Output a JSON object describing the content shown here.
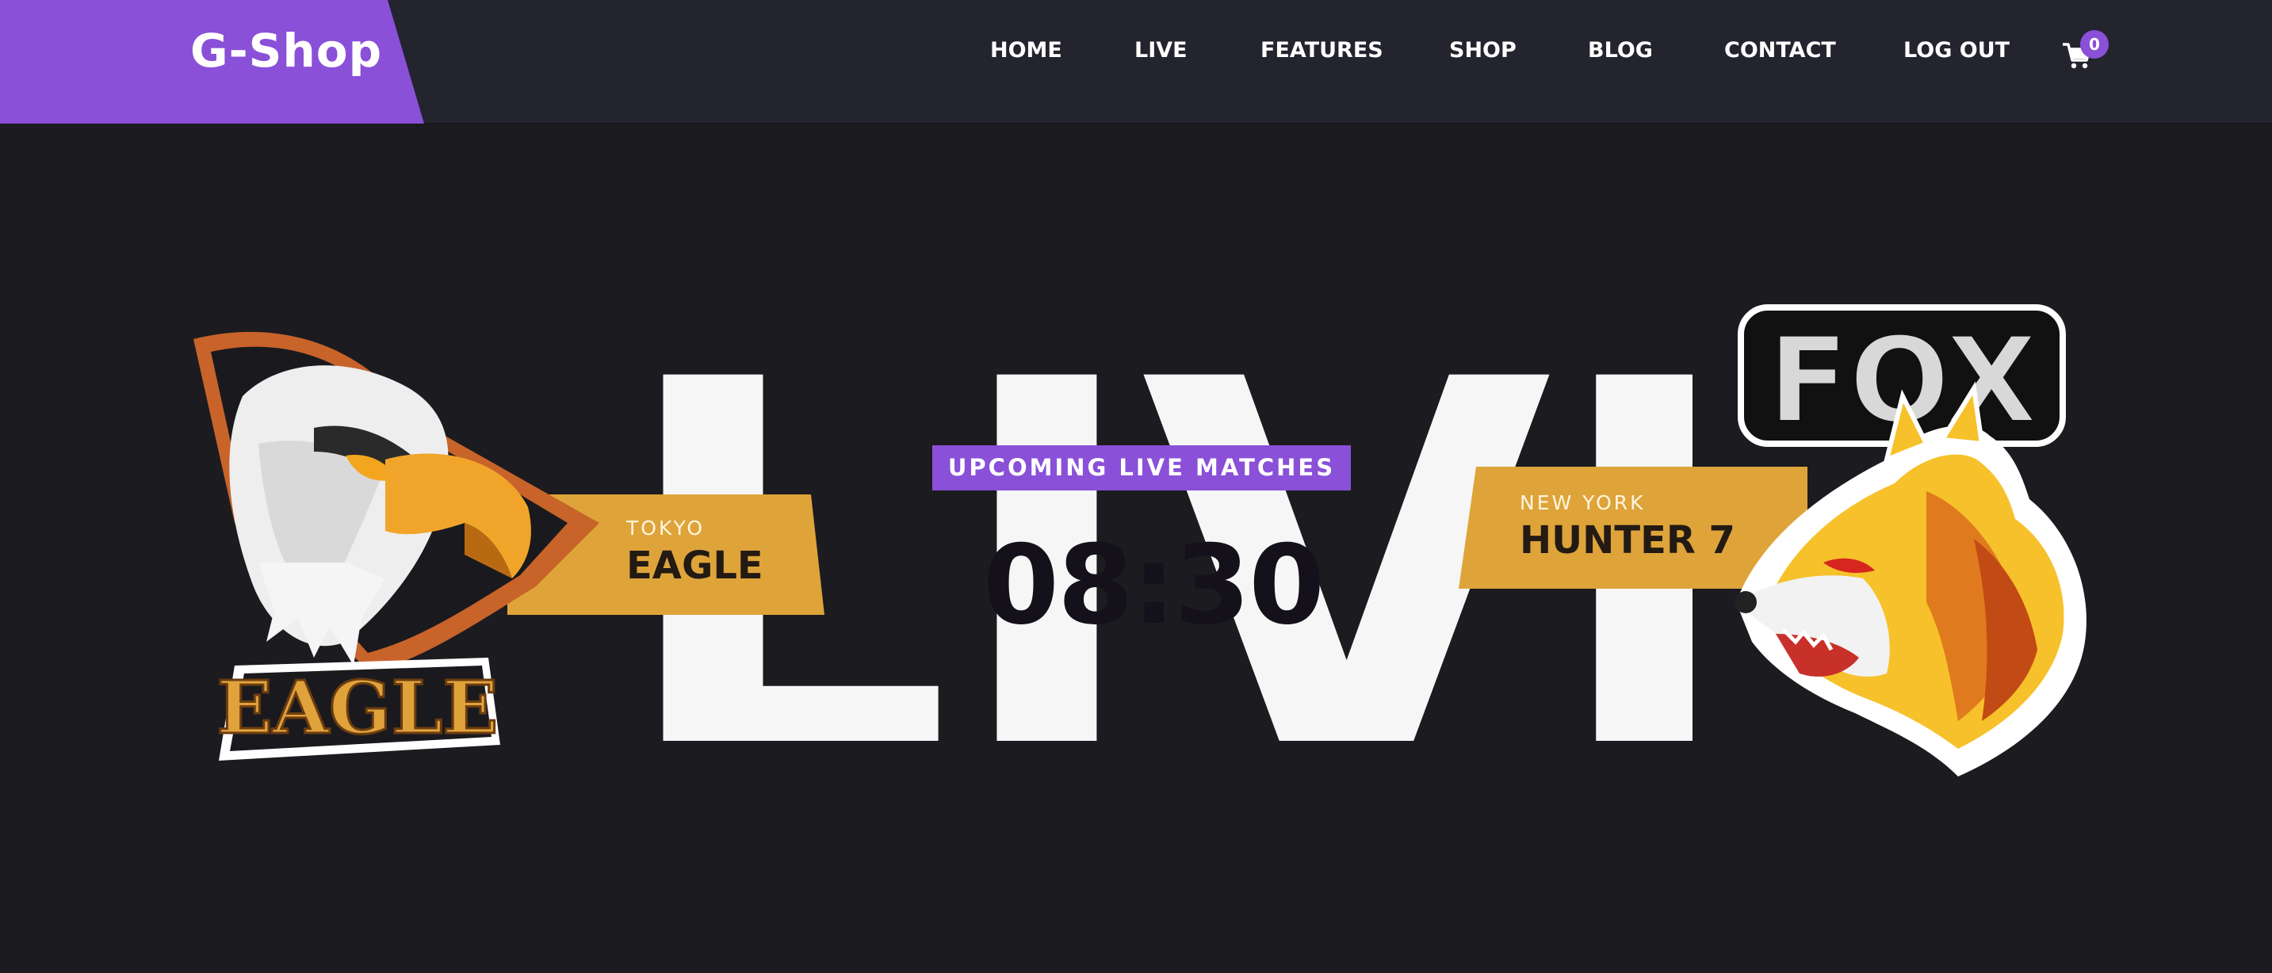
{
  "brand": {
    "name": "G-Shop"
  },
  "nav": {
    "items": [
      {
        "label": "HOME"
      },
      {
        "label": "LIVE"
      },
      {
        "label": "FEATURES"
      },
      {
        "label": "SHOP"
      },
      {
        "label": "BLOG"
      },
      {
        "label": "CONTACT"
      },
      {
        "label": "LOG OUT"
      }
    ],
    "cart": {
      "icon": "cart-icon",
      "count": "0"
    }
  },
  "hero": {
    "background_word": "LIVE",
    "badge_label": "UPCOMING LIVE MATCHES",
    "countdown": "08:30",
    "team_left": {
      "city": "TOKYO",
      "name": "EAGLE",
      "logo_text": "EAGLE",
      "logo": "eagle-logo"
    },
    "team_right": {
      "city": "NEW YORK",
      "name": "HUNTER 7",
      "logo_text": "FOX",
      "logo": "fox-logo"
    }
  },
  "colors": {
    "accent": "#8a50d8",
    "banner": "#dea43a",
    "header_bg": "#24242f",
    "page_bg": "#1c1b20"
  }
}
